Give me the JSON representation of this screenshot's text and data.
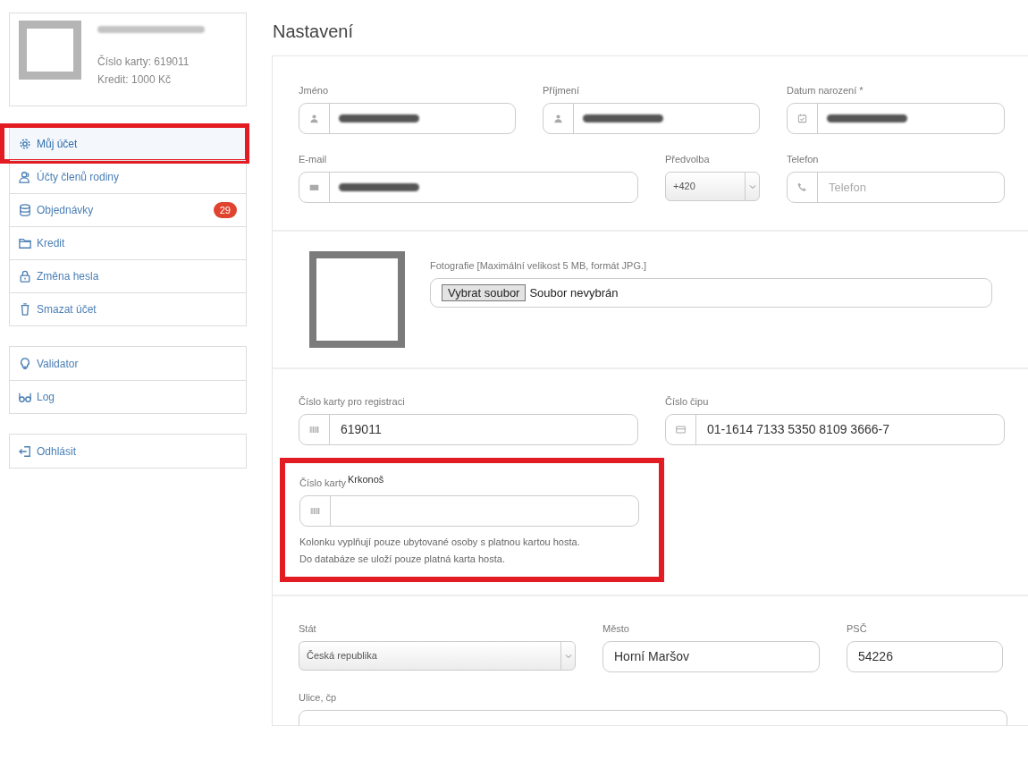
{
  "profile": {
    "name_redacted": true,
    "card_number": "Číslo karty: 619011",
    "credit": "Kredit: 1000 Kč"
  },
  "menu_groups": [
    [
      {
        "label": "Můj účet",
        "selected": true,
        "highlighted": true
      },
      {
        "label": "Účty členů rodiny",
        "selected": false,
        "highlighted": false
      },
      {
        "label": "Objednávky",
        "selected": false,
        "highlighted": false,
        "badge": "29"
      },
      {
        "label": "Kredit",
        "selected": false,
        "highlighted": false
      },
      {
        "label": "Změna hesla",
        "selected": false,
        "highlighted": false
      },
      {
        "label": "Smazat účet",
        "selected": false,
        "highlighted": false
      }
    ],
    [
      {
        "label": "Validator",
        "selected": false,
        "highlighted": false
      },
      {
        "label": "Log",
        "selected": false,
        "highlighted": false
      }
    ],
    [
      {
        "label": "Odhlásit",
        "selected": false,
        "highlighted": false
      }
    ]
  ],
  "page_title": "Nastavení",
  "sections": [
    {
      "kind": "fields",
      "rows": [
        [
          {
            "kind": "text",
            "label": "Jméno",
            "redacted": true
          },
          {
            "kind": "text",
            "label": "Příjmení",
            "redacted": true
          },
          {
            "kind": "text",
            "label": "Datum narození *",
            "redacted": true
          }
        ],
        [
          {
            "kind": "text",
            "label": "E-mail",
            "redacted": true
          },
          {
            "kind": "select",
            "label": "Předvolba",
            "value": "+420"
          },
          {
            "kind": "text",
            "label": "Telefon",
            "placeholder": "Telefon"
          }
        ]
      ]
    },
    {
      "kind": "photo",
      "label": "Fotografie [Maximální velikost 5 MB, formát JPG.]",
      "button": "Vybrat soubor",
      "file_status": "Soubor nevybrán"
    },
    {
      "kind": "cards",
      "rows": [
        [
          {
            "kind": "text",
            "label": "Číslo karty pro registraci",
            "value": "619011"
          },
          {
            "kind": "text",
            "label": "Číslo čipu",
            "value": "01-1614 7133 5350 8109 3666-7"
          }
        ]
      ],
      "extra": {
        "label": "Číslo karty",
        "label_suffix": "Krkonoš",
        "highlighted": true,
        "help": [
          "Kolonku vyplňují pouze ubytované osoby s platnou kartou hosta.",
          "Do databáze se uloží pouze platná karta hosta."
        ]
      }
    },
    {
      "kind": "fields",
      "rows": [
        [
          {
            "kind": "select",
            "label": "Stát",
            "value": "Česká republika"
          },
          {
            "kind": "text",
            "label": "Město",
            "value": "Horní Maršov"
          },
          {
            "kind": "text",
            "label": "PSČ",
            "value": "54226"
          }
        ],
        [
          {
            "kind": "cut",
            "label": "Ulice, čp"
          }
        ]
      ]
    }
  ]
}
